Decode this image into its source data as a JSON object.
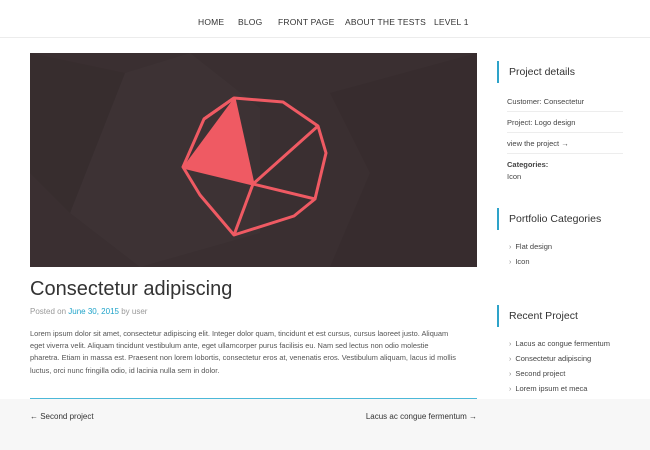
{
  "nav": {
    "items": [
      "HOME",
      "BLOG",
      "FRONT PAGE",
      "ABOUT THE TESTS",
      "LEVEL 1"
    ]
  },
  "hero": {
    "background_color": "#3a2f31",
    "logo_color": "#ef5a63"
  },
  "post": {
    "title": "Consectetur adipiscing",
    "meta_prefix": "Posted on",
    "date": "June 30, 2015",
    "meta_by": "by user",
    "body_lines": [
      "Lorem ipsum dolor sit amet, consectetur adipiscing elit. Integer dolor quam, tincidunt et est cursus, cursus laoreet justo. Aliquam",
      "eget viverra velit. Aliquam tincidunt vestibulum ante, eget ullamcorper purus facilisis eu. Nam sed lectus non odio molestie",
      "pharetra. Etiam in massa est. Praesent non lorem lobortis, consectetur eros at, venenatis eros. Vestibulum aliquam, lacus id mollis",
      "luctus, orci nunc fringilla odio, id lacinia nulla sem in dolor."
    ]
  },
  "post_nav": {
    "prev": "← Second project",
    "next": "Lacus ac congue fermentum →"
  },
  "sidebar": {
    "project_details": {
      "title": "Project details",
      "customer": "Customer: Consectetur",
      "project": "Project: Logo design",
      "view_link": "view the project →",
      "categories_label": "Categories:",
      "categories_value": "Icon"
    },
    "portfolio_categories": {
      "title": "Portfolio Categories",
      "items": [
        "Flat design",
        "Icon"
      ]
    },
    "recent_project": {
      "title": "Recent Project",
      "items": [
        "Lacus ac congue fermentum",
        "Consectetur adipiscing",
        "Second project",
        "Lorem ipsum et meca"
      ]
    }
  },
  "icons": {
    "list_bullet": "chevron-right-icon",
    "arrow_left": "arrow-left-icon",
    "arrow_right": "arrow-right-icon"
  },
  "colors": {
    "accent": "#2ea3c9",
    "link_date": "#1fa3c9",
    "text_dark": "#333333"
  }
}
